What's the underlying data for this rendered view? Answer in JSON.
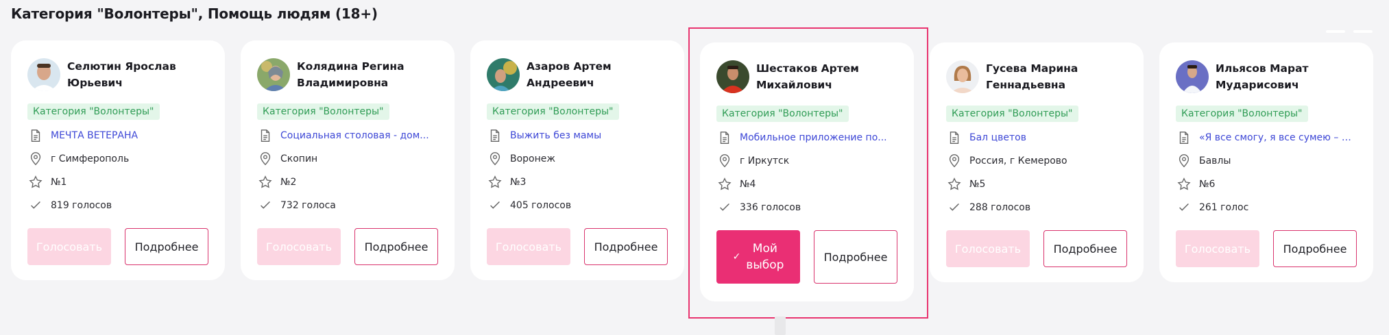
{
  "section_title": "Категория \"Волонтеры\", Помощь людям (18+)",
  "cards": [
    {
      "name_line1": "Селютин Ярослав",
      "name_line2": "Юрьевич",
      "category": "Категория \"Волонтеры\"",
      "project": "МЕЧТА ВЕТЕРАНА",
      "city": "г Симферополь",
      "rank": "№1",
      "votes": "819 голосов",
      "vote_label": "Голосовать",
      "more_label": "Подробнее"
    },
    {
      "name_line1": "Колядина Регина",
      "name_line2": "Владимировна",
      "category": "Категория \"Волонтеры\"",
      "project": "Социальная столовая - дом...",
      "city": "Скопин",
      "rank": "№2",
      "votes": "732 голоса",
      "vote_label": "Голосовать",
      "more_label": "Подробнее"
    },
    {
      "name_line1": "Азаров Артем Андреевич",
      "name_line2": "",
      "category": "Категория \"Волонтеры\"",
      "project": "Выжить без мамы",
      "city": "Воронеж",
      "rank": "№3",
      "votes": "405 голосов",
      "vote_label": "Голосовать",
      "more_label": "Подробнее"
    },
    {
      "name_line1": "Шестаков Артем",
      "name_line2": "Михайлович",
      "category": "Категория \"Волонтеры\"",
      "project": "Мобильное приложение по...",
      "city": "г Иркутск",
      "rank": "№4",
      "votes": "336 голосов",
      "mine_line1": "Мой",
      "mine_line2": "выбор",
      "more_label": "Подробнее"
    },
    {
      "name_line1": "Гусева Марина",
      "name_line2": "Геннадьевна",
      "category": "Категория \"Волонтеры\"",
      "project": "Бал цветов",
      "city": "Россия, г Кемерово",
      "rank": "№5",
      "votes": "288 голосов",
      "vote_label": "Голосовать",
      "more_label": "Подробнее"
    },
    {
      "name_line1": "Ильясов Марат",
      "name_line2": "Мударисович",
      "category": "Категория \"Волонтеры\"",
      "project": "«Я все смогу, я все сумею – ина...",
      "city": "Бавлы",
      "rank": "№6",
      "votes": "261 голос",
      "vote_label": "Голосовать",
      "more_label": "Подробнее"
    }
  ],
  "colors": {
    "accent": "#ea2f74",
    "vote_disabled": "#fcd6e2",
    "category_bg": "#e3f6e9",
    "category_text": "#2f9c55",
    "link": "#3d47d6",
    "highlight_border": "#e8336f"
  },
  "icons": {
    "project": "document-icon",
    "city": "location-pin-icon",
    "rank": "star-icon",
    "votes": "checkmark-icon"
  }
}
